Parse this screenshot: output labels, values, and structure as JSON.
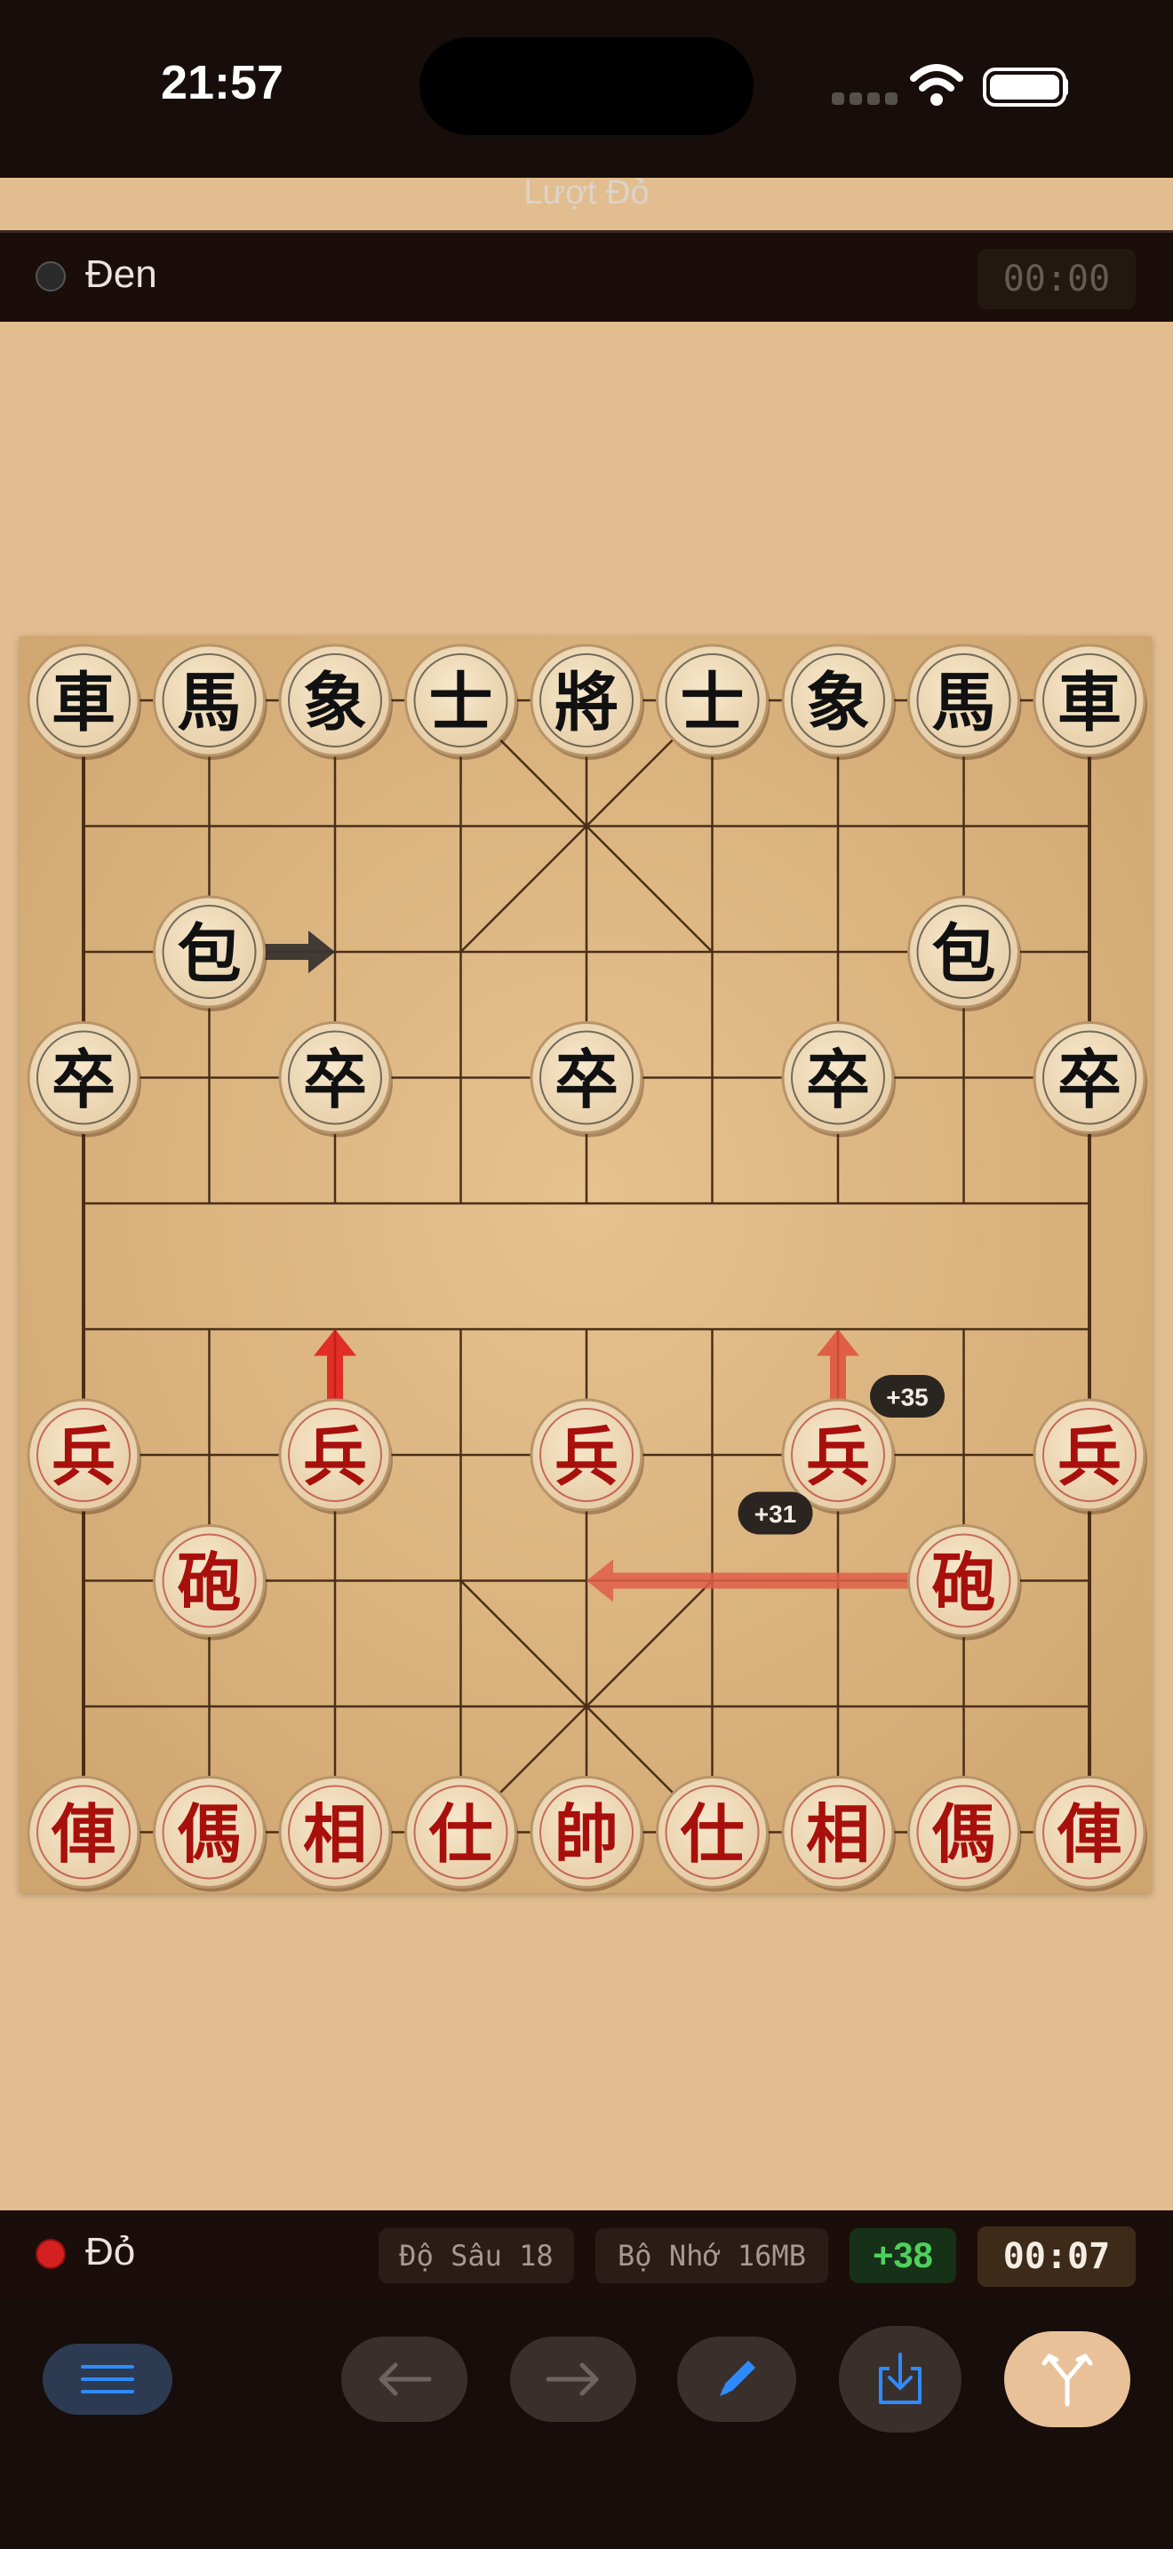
{
  "status_bar": {
    "time": "21:57"
  },
  "header": {
    "turn_label": "Lượt Đỏ"
  },
  "black_player": {
    "name": "Đen",
    "timer": "00:00",
    "dot_color": "#2b2b2b"
  },
  "red_player": {
    "name": "Đỏ",
    "depth": "Độ Sâu 18",
    "memory": "Bộ Nhớ 16MB",
    "score": "+38",
    "timer": "00:07",
    "dot_color": "#d42020"
  },
  "board": {
    "black_pieces": [
      {
        "char": "車",
        "file": 0,
        "rank": 0
      },
      {
        "char": "馬",
        "file": 1,
        "rank": 0
      },
      {
        "char": "象",
        "file": 2,
        "rank": 0
      },
      {
        "char": "士",
        "file": 3,
        "rank": 0
      },
      {
        "char": "將",
        "file": 4,
        "rank": 0
      },
      {
        "char": "士",
        "file": 5,
        "rank": 0
      },
      {
        "char": "象",
        "file": 6,
        "rank": 0
      },
      {
        "char": "馬",
        "file": 7,
        "rank": 0
      },
      {
        "char": "車",
        "file": 8,
        "rank": 0
      },
      {
        "char": "包",
        "file": 1,
        "rank": 2
      },
      {
        "char": "包",
        "file": 7,
        "rank": 2
      },
      {
        "char": "卒",
        "file": 0,
        "rank": 3
      },
      {
        "char": "卒",
        "file": 2,
        "rank": 3
      },
      {
        "char": "卒",
        "file": 4,
        "rank": 3
      },
      {
        "char": "卒",
        "file": 6,
        "rank": 3
      },
      {
        "char": "卒",
        "file": 8,
        "rank": 3
      }
    ],
    "red_pieces": [
      {
        "char": "兵",
        "file": 0,
        "rank": 6
      },
      {
        "char": "兵",
        "file": 2,
        "rank": 6
      },
      {
        "char": "兵",
        "file": 4,
        "rank": 6
      },
      {
        "char": "兵",
        "file": 6,
        "rank": 6
      },
      {
        "char": "兵",
        "file": 8,
        "rank": 6
      },
      {
        "char": "砲",
        "file": 1,
        "rank": 7
      },
      {
        "char": "砲",
        "file": 7,
        "rank": 7
      },
      {
        "char": "俥",
        "file": 0,
        "rank": 9
      },
      {
        "char": "傌",
        "file": 1,
        "rank": 9
      },
      {
        "char": "相",
        "file": 2,
        "rank": 9
      },
      {
        "char": "仕",
        "file": 3,
        "rank": 9
      },
      {
        "char": "帥",
        "file": 4,
        "rank": 9
      },
      {
        "char": "仕",
        "file": 5,
        "rank": 9
      },
      {
        "char": "相",
        "file": 6,
        "rank": 9
      },
      {
        "char": "傌",
        "file": 7,
        "rank": 9
      },
      {
        "char": "俥",
        "file": 8,
        "rank": 9
      }
    ],
    "hint_arrows": [
      {
        "color": "#3a3430",
        "from": [
          1,
          2
        ],
        "to": [
          2,
          2
        ],
        "score": ""
      },
      {
        "color": "#e01818",
        "from": [
          2,
          6
        ],
        "to": [
          2,
          5
        ],
        "score": ""
      },
      {
        "color": "#e0503c",
        "from": [
          6,
          6
        ],
        "to": [
          6,
          5
        ],
        "score": "+35"
      },
      {
        "color": "#e0604a",
        "from": [
          7,
          7
        ],
        "to": [
          4,
          7
        ],
        "score": "+31"
      }
    ],
    "colors": {
      "black_text": "#111111",
      "red_text": "#a8100c",
      "grid_line": "#4a2e18"
    }
  },
  "toolbar": {
    "menu_icon": "hamburger-menu-icon",
    "back_icon": "arrow-left-icon",
    "forward_icon": "arrow-right-icon",
    "edit_icon": "pencil-icon",
    "save_icon": "download-tray-icon",
    "branch_icon": "branch-fork-icon"
  }
}
